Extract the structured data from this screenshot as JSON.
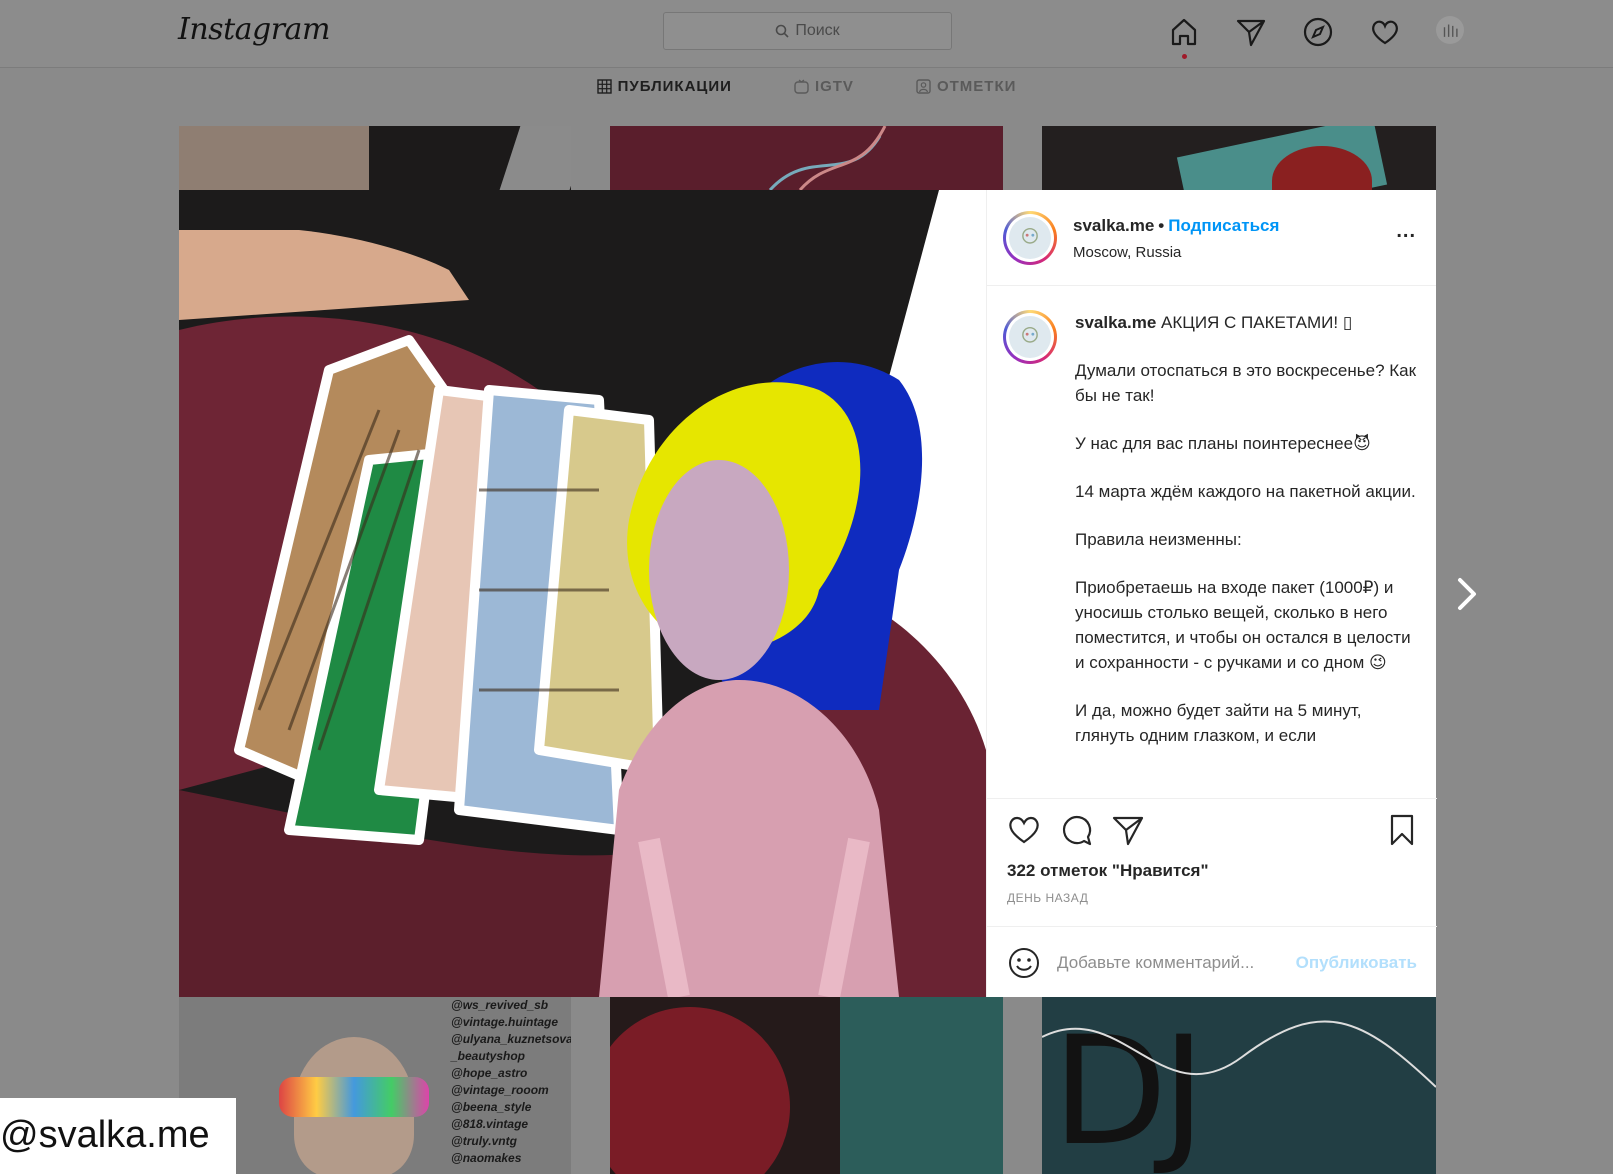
{
  "app": {
    "logo_text": "Instagram",
    "search_placeholder": "Поиск"
  },
  "nav_icons": [
    "home-icon",
    "direct-icon",
    "explore-icon",
    "activity-icon",
    "profile-avatar"
  ],
  "profile_tabs": [
    {
      "label": "ПУБЛИКАЦИИ",
      "icon": "grid-icon",
      "active": true
    },
    {
      "label": "IGTV",
      "icon": "igtv-icon",
      "active": false
    },
    {
      "label": "ОТМЕТКИ",
      "icon": "tagged-icon",
      "active": false
    }
  ],
  "post": {
    "username": "svalka.me",
    "separator": "•",
    "follow_label": "Подписаться",
    "location": "Moscow, Russia",
    "more_label": "...",
    "caption_username": "svalka.me",
    "caption_title": " АКЦИЯ С ПАКЕТАМИ! ▯",
    "caption_paragraphs": [
      "Думали отоспаться в это воскресенье? Как бы не так!",
      "У нас для вас планы поинтереснее😈",
      "14 марта ждём каждого на пакетной акции.",
      "Правила неизменны:",
      "Приобретаешь на входе пакет (1000₽) и уносишь столько вещей, сколько в него поместится, и чтобы он остался в целости и сохранности - с ручками и со дном 😉",
      "И да, можно будет зайти на 5 минут, глянуть одним глазком, и если"
    ],
    "likes_text": "322 отметок \"Нравится\"",
    "time_ago": "ДЕНЬ НАЗАД",
    "comment_placeholder": "Добавьте комментарий...",
    "publish_label": "Опубликовать"
  },
  "background_tiles": {
    "handles": [
      "@ws_revived_sb",
      "@vintage.huintage",
      "@ulyana_kuznetsova",
      "_beautyshop",
      "@hope_astro",
      "@vintage_rooom",
      "@beena_style",
      "@818.vintage",
      "@truly.vntg",
      "@naomakes"
    ],
    "dj_text": "DJ"
  },
  "watermark": "@svalka.me",
  "colors": {
    "accent_blue": "#0095f6",
    "publish_disabled": "#b2dffc",
    "overlay_gray": "#8a8a8a"
  }
}
